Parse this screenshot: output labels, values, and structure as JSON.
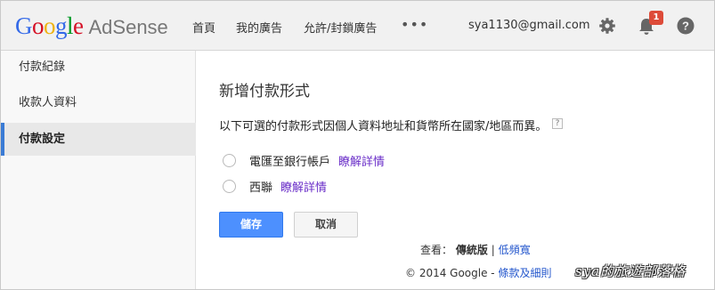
{
  "header": {
    "logo_google": [
      "G",
      "o",
      "o",
      "g",
      "l",
      "e"
    ],
    "logo_product": "AdSense",
    "nav": {
      "home": "首頁",
      "my_ads": "我的廣告",
      "allow_block": "允許/封鎖廣告",
      "more": "•••"
    },
    "email": "sya1130@gmail.com",
    "notification_count": "1"
  },
  "sidebar": {
    "items": [
      {
        "label": "付款紀錄",
        "active": false
      },
      {
        "label": "收款人資料",
        "active": false
      },
      {
        "label": "付款設定",
        "active": true
      }
    ]
  },
  "main": {
    "title": "新增付款形式",
    "description": "以下可選的付款形式因個人資料地址和貨幣所在國家/地區而異。",
    "help": "?",
    "options": [
      {
        "label": "電匯至銀行帳戶",
        "link": "瞭解詳情"
      },
      {
        "label": "西聯",
        "link": "瞭解詳情"
      }
    ],
    "save_label": "儲存",
    "cancel_label": "取消"
  },
  "view": {
    "prefix": "查看：",
    "current": "傳統版",
    "sep": "|",
    "alt": "低頻寬"
  },
  "footer": {
    "copyright": "© 2014 Google -",
    "terms": "條款及細則"
  },
  "watermark": "sya的旅遊部落格",
  "colors": {
    "accent": "#4d90fe",
    "badge": "#dd4b39",
    "link": "#6a2ec8",
    "active_bar": "#3a7bd5"
  }
}
